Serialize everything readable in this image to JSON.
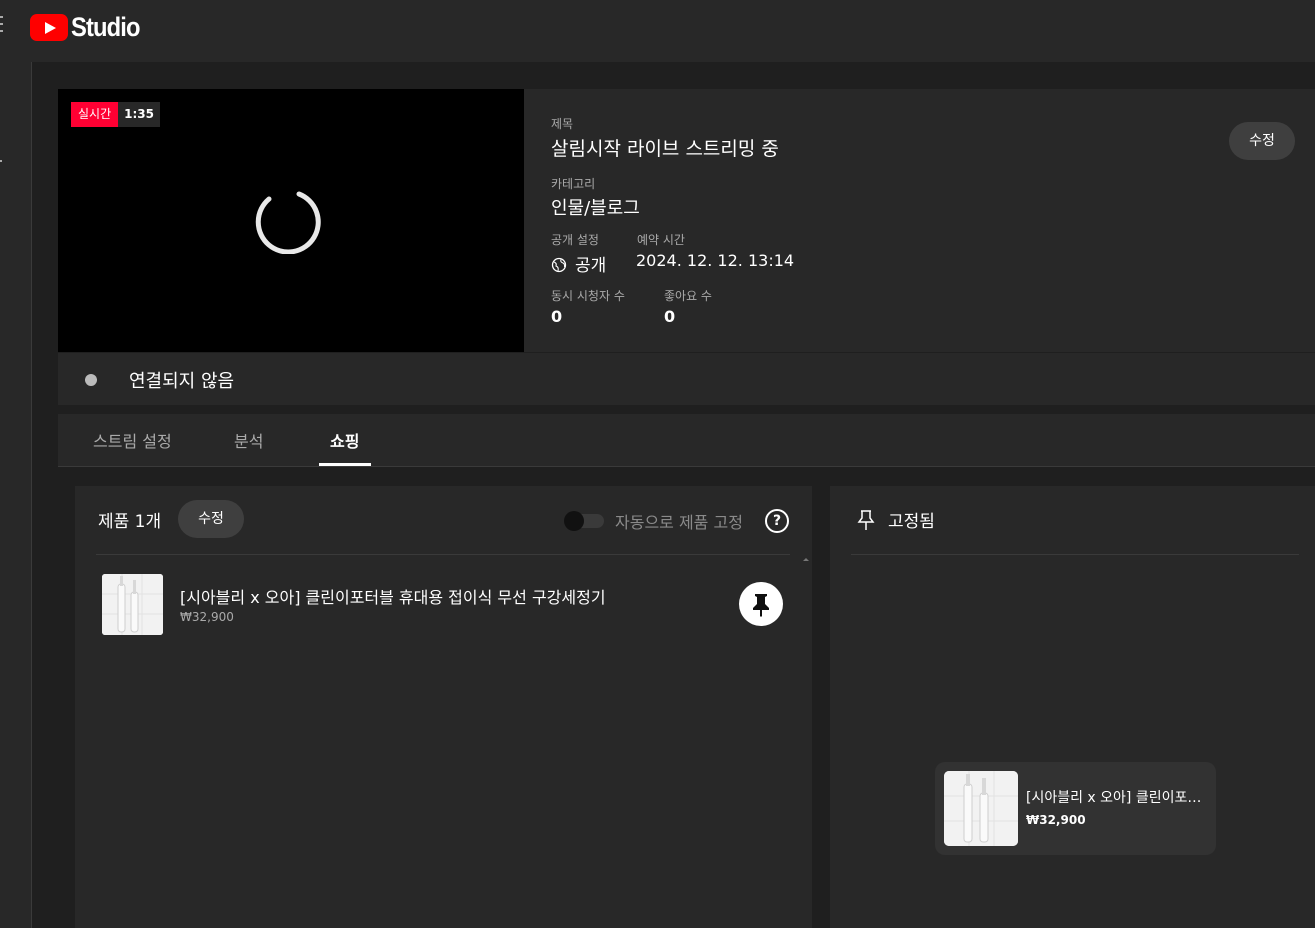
{
  "app": {
    "logo_text": "Studio"
  },
  "player": {
    "live_label": "실시간",
    "elapsed": "1:35"
  },
  "details": {
    "title_label": "제목",
    "title": "살림시작 라이브 스트리밍 중",
    "category_label": "카테고리",
    "category": "인물/블로그",
    "visibility_label": "공개 설정",
    "visibility": "공개",
    "schedule_label": "예약 시간",
    "schedule": "2024. 12. 12. 13:14",
    "viewers_label": "동시 시청자 수",
    "viewers": "0",
    "likes_label": "좋아요 수",
    "likes": "0",
    "edit_label": "수정"
  },
  "connection": {
    "status": "연결되지 않음"
  },
  "tabs": [
    {
      "label": "스트림 설정",
      "active": false
    },
    {
      "label": "분석",
      "active": false
    },
    {
      "label": "쇼핑",
      "active": true
    }
  ],
  "products": {
    "header": "제품 1개",
    "edit_label": "수정",
    "auto_pin_label": "자동으로 제품 고정",
    "auto_pin_enabled": false,
    "help_glyph": "?",
    "items": [
      {
        "name": "[시아블리 x 오아] 클린이포터블 휴대용 접이식 무선 구강세정기",
        "price": "₩32,900"
      }
    ]
  },
  "pinned": {
    "title": "고정됨",
    "card": {
      "name": "[시아블리 x 오아] 클린이포터블 휴대용 접이식 무선 구강세정기",
      "price": "₩32,900"
    }
  },
  "icons": [
    "youtube-logo-icon",
    "globe-icon",
    "pin-icon",
    "pin-outline-icon",
    "help-icon",
    "loading-spinner-icon"
  ],
  "colors": {
    "live_red": "#ff0033",
    "brand_red": "#ff0000",
    "background": "#1f1f1f",
    "panel": "#282828"
  }
}
